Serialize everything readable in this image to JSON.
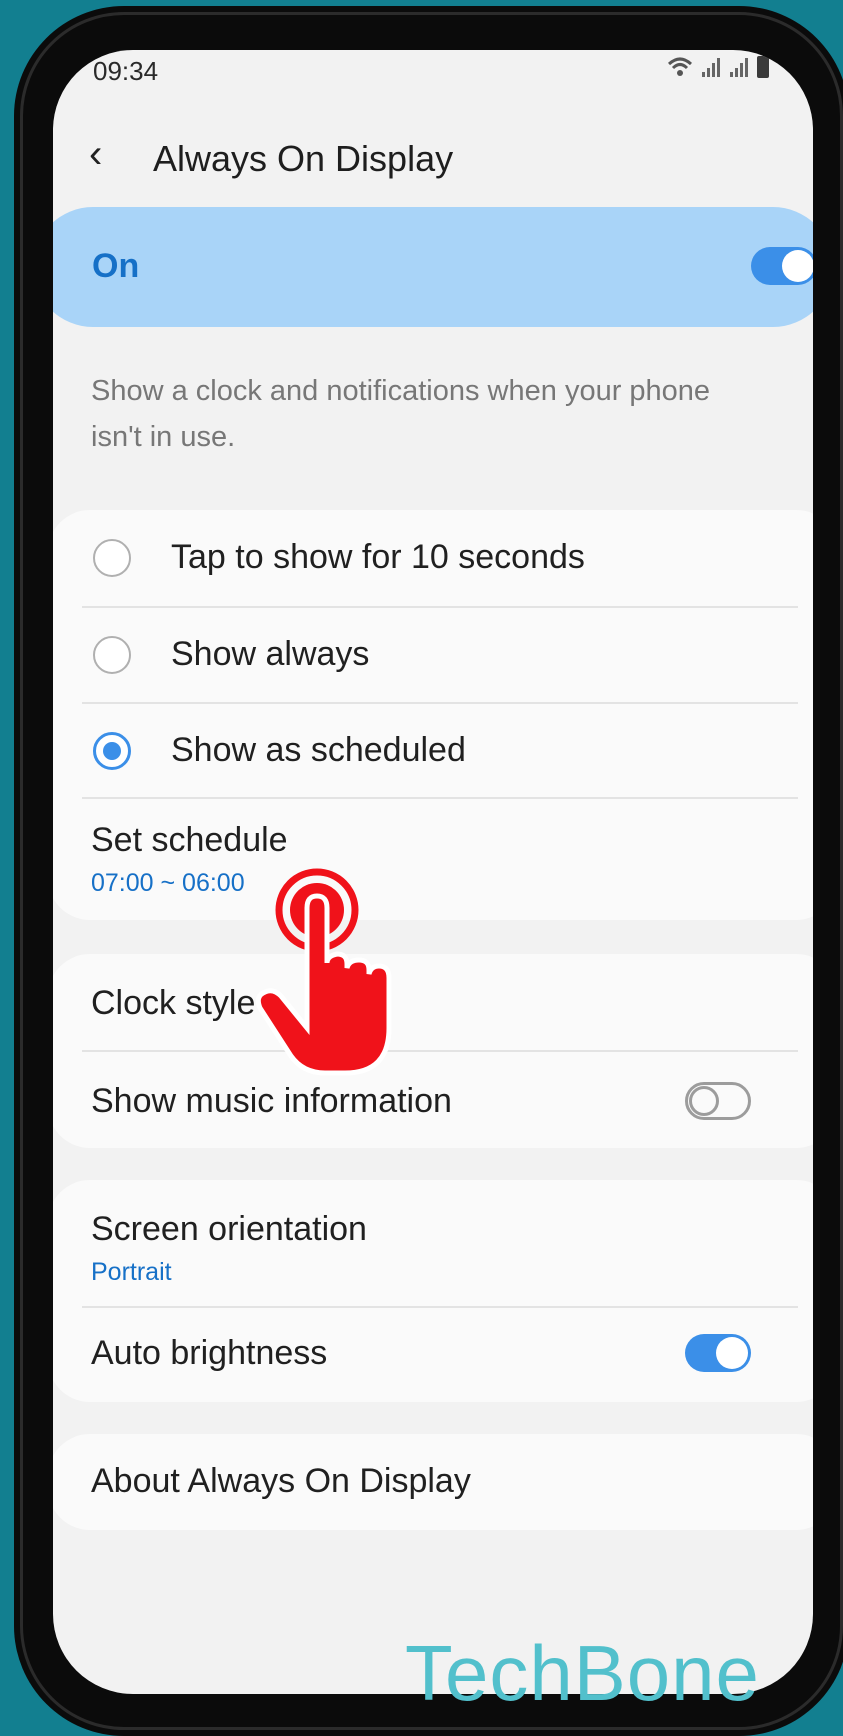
{
  "statusbar": {
    "time": "09:34"
  },
  "header": {
    "title": "Always On Display"
  },
  "master_switch": {
    "label": "On",
    "state": "on"
  },
  "description": "Show a clock and notifications when your phone isn't in use.",
  "display_mode": {
    "options": [
      {
        "label": "Tap to show for 10 seconds",
        "selected": false
      },
      {
        "label": "Show always",
        "selected": false
      },
      {
        "label": "Show as scheduled",
        "selected": true
      }
    ],
    "schedule": {
      "label": "Set schedule",
      "value": "07:00 ~ 06:00"
    }
  },
  "appearance": {
    "clock_style": "Clock style",
    "music_info": {
      "label": "Show music information",
      "state": "off"
    }
  },
  "screen": {
    "orientation": {
      "label": "Screen orientation",
      "value": "Portrait"
    },
    "auto_brightness": {
      "label": "Auto brightness",
      "state": "on"
    }
  },
  "about": "About Always On Display",
  "watermark": "TechBone",
  "colors": {
    "accent": "#3b8fe8",
    "master_bg": "#a9d4f8",
    "background": "#127f90",
    "tap_hand": "#f0121a"
  }
}
